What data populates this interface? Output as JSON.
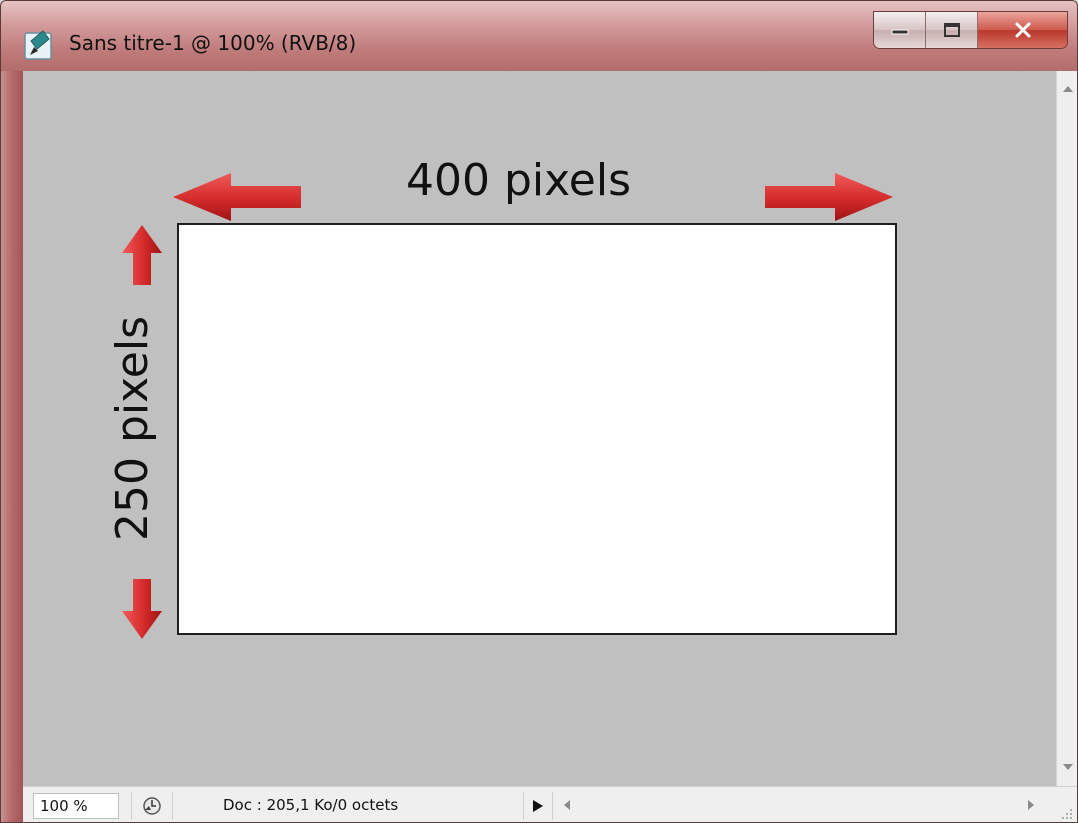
{
  "window": {
    "title": "Sans titre-1 @ 100% (RVB/8)",
    "accent_color": "#c07b7b",
    "controls": {
      "minimize_icon": "minimize-icon",
      "maximize_icon": "maximize-icon",
      "close_icon": "close-icon"
    }
  },
  "canvas": {
    "background_color": "#c0c0c0",
    "document_color": "#ffffff",
    "width_label": "400 pixels",
    "height_label": "250 pixels",
    "arrow_color": "#d42a2a"
  },
  "statusbar": {
    "zoom_value": "100 %",
    "doc_info": "Doc : 205,1 Ko/0 octets"
  }
}
